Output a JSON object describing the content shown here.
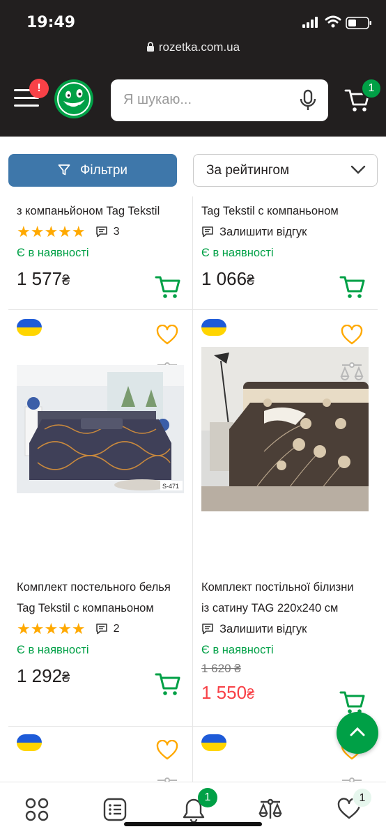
{
  "status_bar": {
    "time": "19:49"
  },
  "browser": {
    "url": "rozetka.com.ua"
  },
  "header": {
    "menu_badge": "!",
    "search_placeholder": "Я шукаю...",
    "cart_count": "1"
  },
  "toolbar": {
    "filters_label": "Фільтри",
    "sort_label": "За рейтингом"
  },
  "products": [
    {
      "title_lines": [
        "з компаньйоном Tag Tekstil"
      ],
      "rating_stars": 5,
      "reviews": "3",
      "stock": "Є в наявності",
      "price": "1 577",
      "currency": "₴"
    },
    {
      "title_lines": [
        "Tag Tekstil с компаньоном"
      ],
      "review_cta": "Залишити відгук",
      "stock": "Є в наявності",
      "price": "1 066",
      "currency": "₴"
    },
    {
      "title_lines": [
        "Комплект постельного белья",
        "Tag Tekstil с компаньоном"
      ],
      "image_code": "S-471",
      "rating_stars": 5,
      "reviews": "2",
      "stock": "Є в наявності",
      "price": "1 292",
      "currency": "₴"
    },
    {
      "title_lines": [
        "Комплект постільної білизни",
        "із сатину TAG 220x240 см"
      ],
      "review_cta": "Залишити відгук",
      "stock": "Є в наявності",
      "old_price": "1 620 ₴",
      "price": "1 550",
      "currency": "₴"
    }
  ],
  "stars_text": "★★★★★",
  "tabbar": {
    "notifications_count": "1",
    "wishlist_count": "1"
  },
  "colors": {
    "header_bg": "#221f1f",
    "accent_green": "#00a046",
    "filter_blue": "#3e77aa",
    "price_red": "#f84147",
    "star_yellow": "#ffa900",
    "heart_orange": "#ffa900"
  }
}
